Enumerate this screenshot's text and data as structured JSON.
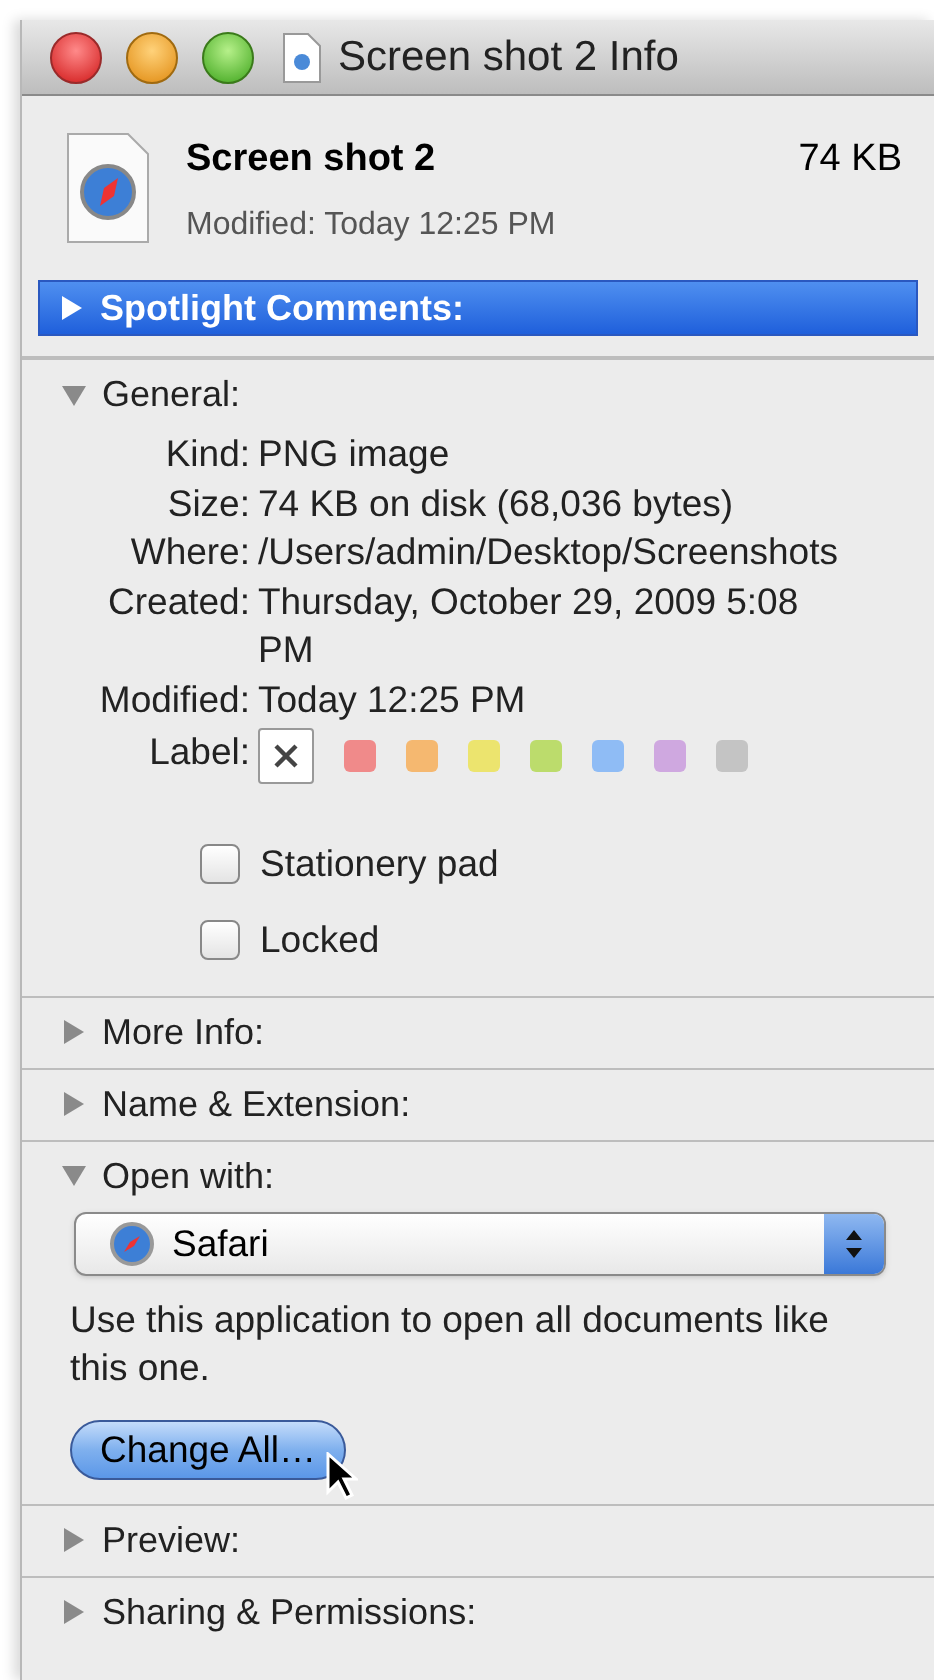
{
  "window": {
    "title": "Screen shot 2 Info"
  },
  "header": {
    "name": "Screen shot 2",
    "size": "74 KB",
    "modified": "Modified: Today 12:25 PM"
  },
  "sections": [
    {
      "kind": "comments",
      "title": "Spotlight Comments:",
      "expanded": false,
      "selected": true
    },
    {
      "kind": "general",
      "title": "General:",
      "expanded": true,
      "selected": false,
      "fields": [
        {
          "label": "Kind:",
          "value": "PNG image"
        },
        {
          "label": "Size:",
          "value": "74 KB on disk (68,036 bytes)"
        },
        {
          "label": "Where:",
          "value": "/Users/admin/Desktop/Screenshots"
        },
        {
          "label": "Created:",
          "value": "Thursday, October 29, 2009 5:08 PM"
        },
        {
          "label": "Modified:",
          "value": "Today 12:25 PM"
        }
      ],
      "label_field": {
        "label": "Label:",
        "options": [
          {
            "kind": "none",
            "selected": true
          },
          {
            "kind": "color",
            "color": "#f08a8a",
            "selected": false
          },
          {
            "kind": "color",
            "color": "#f5b870",
            "selected": false
          },
          {
            "kind": "color",
            "color": "#ece46e",
            "selected": false
          },
          {
            "kind": "color",
            "color": "#bcdc6c",
            "selected": false
          },
          {
            "kind": "color",
            "color": "#8fbcf5",
            "selected": false
          },
          {
            "kind": "color",
            "color": "#cfa8e0",
            "selected": false
          },
          {
            "kind": "color",
            "color": "#c4c4c4",
            "selected": false
          }
        ]
      },
      "checkboxes": [
        {
          "label": "Stationery pad",
          "checked": false
        },
        {
          "label": "Locked",
          "checked": false
        }
      ]
    },
    {
      "kind": "plain",
      "title": "More Info:",
      "expanded": false,
      "selected": false
    },
    {
      "kind": "plain",
      "title": "Name & Extension:",
      "expanded": false,
      "selected": false
    },
    {
      "kind": "open_with",
      "title": "Open with:",
      "expanded": true,
      "selected": false,
      "app": "Safari",
      "description": "Use this application to open all documents like this one.",
      "button": "Change All…"
    },
    {
      "kind": "plain",
      "title": "Preview:",
      "expanded": false,
      "selected": false
    },
    {
      "kind": "plain",
      "title": "Sharing & Permissions:",
      "expanded": false,
      "selected": false
    }
  ]
}
